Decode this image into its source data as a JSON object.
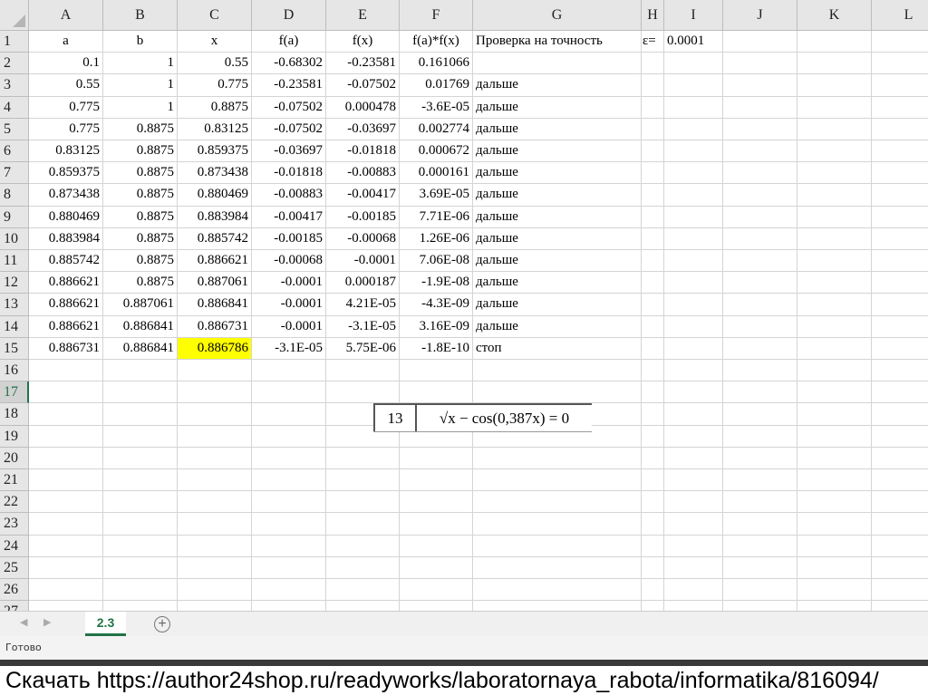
{
  "columns": [
    "A",
    "B",
    "C",
    "D",
    "E",
    "F",
    "G",
    "H",
    "I",
    "J",
    "K",
    "L"
  ],
  "row_count": 27,
  "selected_row": 17,
  "rows": [
    [
      "a",
      "b",
      "x",
      "f(a)",
      "f(x)",
      "f(a)*f(x)",
      "Проверка на точность",
      "ε=",
      "0.0001"
    ],
    [
      "0.1",
      "1",
      "0.55",
      "-0.68302",
      "-0.23581",
      "0.161066",
      ""
    ],
    [
      "0.55",
      "1",
      "0.775",
      "-0.23581",
      "-0.07502",
      "0.01769",
      "дальше"
    ],
    [
      "0.775",
      "1",
      "0.8875",
      "-0.07502",
      "0.000478",
      "-3.6E-05",
      "дальше"
    ],
    [
      "0.775",
      "0.8875",
      "0.83125",
      "-0.07502",
      "-0.03697",
      "0.002774",
      "дальше"
    ],
    [
      "0.83125",
      "0.8875",
      "0.859375",
      "-0.03697",
      "-0.01818",
      "0.000672",
      "дальше"
    ],
    [
      "0.859375",
      "0.8875",
      "0.873438",
      "-0.01818",
      "-0.00883",
      "0.000161",
      "дальше"
    ],
    [
      "0.873438",
      "0.8875",
      "0.880469",
      "-0.00883",
      "-0.00417",
      "3.69E-05",
      "дальше"
    ],
    [
      "0.880469",
      "0.8875",
      "0.883984",
      "-0.00417",
      "-0.00185",
      "7.71E-06",
      "дальше"
    ],
    [
      "0.883984",
      "0.8875",
      "0.885742",
      "-0.00185",
      "-0.00068",
      "1.26E-06",
      "дальше"
    ],
    [
      "0.885742",
      "0.8875",
      "0.886621",
      "-0.00068",
      "-0.0001",
      "7.06E-08",
      "дальше"
    ],
    [
      "0.886621",
      "0.8875",
      "0.887061",
      "-0.0001",
      "0.000187",
      "-1.9E-08",
      "дальше"
    ],
    [
      "0.886621",
      "0.887061",
      "0.886841",
      "-0.0001",
      "4.21E-05",
      "-4.3E-09",
      "дальше"
    ],
    [
      "0.886621",
      "0.886841",
      "0.886731",
      "-0.0001",
      "-3.1E-05",
      "3.16E-09",
      "дальше"
    ],
    [
      "0.886731",
      "0.886841",
      "0.886786",
      "-3.1E-05",
      "5.75E-06",
      "-1.8E-10",
      "стоп"
    ]
  ],
  "highlight_cell": "C15",
  "highlight_color": "#ffff00",
  "equation": {
    "number": "13",
    "formula": "√x − cos(0,387x) = 0"
  },
  "sheet_tab": "2.3",
  "add_sheet_icon": "plus-circle-icon",
  "status": "Готово",
  "footer": "Скачать https://author24shop.ru/readyworks/laboratornaya_rabota/informatika/816094/"
}
